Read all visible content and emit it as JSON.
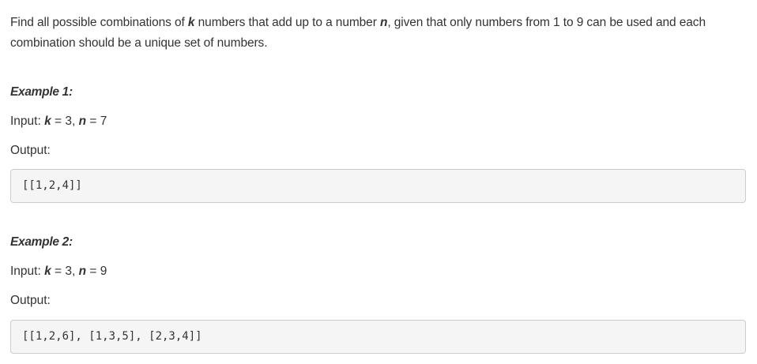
{
  "problem": {
    "part1": "Find all possible combinations of ",
    "var_k": "k",
    "part2": " numbers that add up to a number ",
    "var_n": "n",
    "part3": ", given that only numbers from 1 to 9 can be used and each combination should be a unique set of numbers."
  },
  "examples": [
    {
      "title": "Example 1:",
      "input_label": "Input: ",
      "k_name": "k",
      "k_eq": " = 3, ",
      "n_name": "n",
      "n_eq": " = 7",
      "output_label": "Output:",
      "output_value": "[[1,2,4]]"
    },
    {
      "title": "Example 2:",
      "input_label": "Input: ",
      "k_name": "k",
      "k_eq": " = 3, ",
      "n_name": "n",
      "n_eq": " = 9",
      "output_label": "Output:",
      "output_value": "[[1,2,6], [1,3,5], [2,3,4]]"
    }
  ]
}
